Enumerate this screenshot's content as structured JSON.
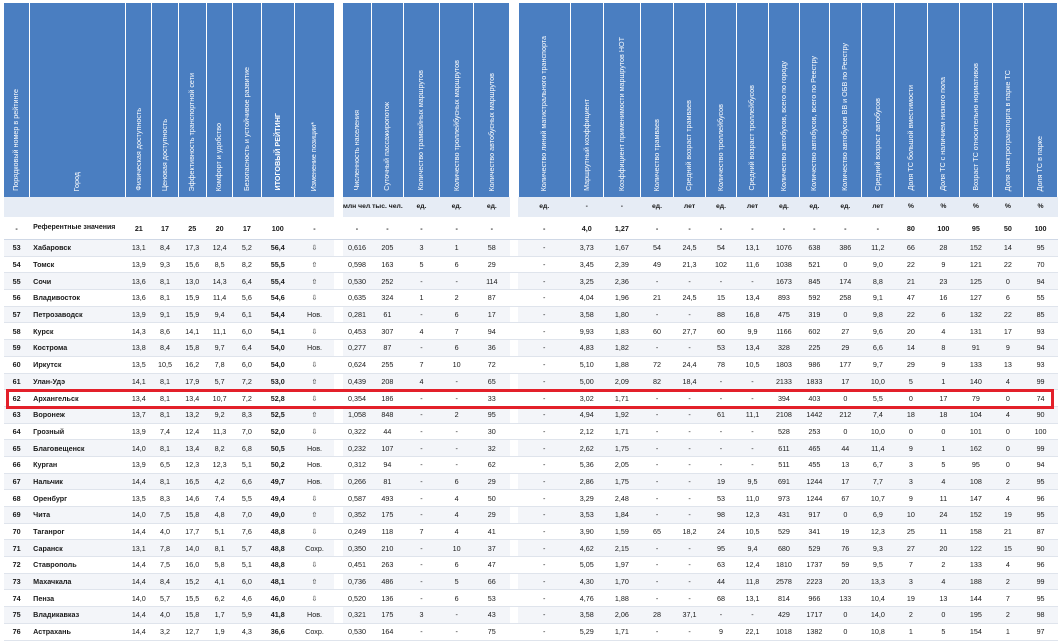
{
  "headers": [
    "Порядковый номер в рейтинге",
    "Город",
    "Физическая доступность",
    "Ценовая доступность",
    "Эффективность транспортной сети",
    "Комфорт и удобство",
    "Безопасность и устойчивое развитие",
    "ИТОГОВЫЙ РЕЙТИНГ",
    "Изменение позиции*",
    "",
    "Численность населения",
    "Суточный пассажиропоток",
    "Количество трамвайных маршрутов",
    "Количество троллейбусных маршрутов",
    "Количество автобусных маршрутов",
    "",
    "Количество линий магистрального транспорта",
    "Маршрутный коэффициент",
    "Коэффициент применимости маршрутов НОТ",
    "Количество трамваев",
    "Средний возраст трамваев",
    "Количество троллейбусов",
    "Средний возраст троллейбусов",
    "Количество автобусов, всего по городу",
    "Количество автобусов, всего по Реестру",
    "Количество автобусов ВВ и ОБВ по Реестру",
    "Средний возраст автобусов",
    "Доля ТС большой вместимости",
    "Доля ТС с наличием низкого пола",
    "Возраст ТС относительно нормативов",
    "Доля электротранспорта в парке ТС",
    "Доля ТС в парке"
  ],
  "units": [
    "",
    "",
    "",
    "",
    "",
    "",
    "",
    "",
    "",
    "",
    "млн чел.",
    "тыс. чел.",
    "ед.",
    "ед.",
    "ед.",
    "",
    "ед.",
    "-",
    "-",
    "ед.",
    "лет",
    "ед.",
    "лет",
    "ед.",
    "ед.",
    "ед.",
    "лет",
    "%",
    "%",
    "%",
    "%",
    "%"
  ],
  "reference": [
    "-",
    "Референтные значения",
    "21",
    "17",
    "25",
    "20",
    "17",
    "100",
    "-",
    "",
    "-",
    "-",
    "-",
    "-",
    "-",
    "",
    "-",
    "4,0",
    "1,27",
    "-",
    "-",
    "-",
    "-",
    "-",
    "-",
    "-",
    "-",
    "80",
    "100",
    "95",
    "50",
    "100"
  ],
  "rows": [
    [
      "53",
      "Хабаровск",
      "13,1",
      "8,4",
      "17,3",
      "12,4",
      "5,2",
      "56,4",
      "⇩",
      "",
      "0,616",
      "205",
      "3",
      "1",
      "58",
      "",
      "-",
      "3,73",
      "1,67",
      "54",
      "24,5",
      "54",
      "13,1",
      "1076",
      "638",
      "386",
      "11,2",
      "66",
      "28",
      "152",
      "14",
      "95"
    ],
    [
      "54",
      "Томск",
      "13,9",
      "9,3",
      "15,6",
      "8,5",
      "8,2",
      "55,5",
      "⇧",
      "",
      "0,598",
      "163",
      "5",
      "6",
      "29",
      "",
      "-",
      "3,45",
      "2,39",
      "49",
      "21,3",
      "102",
      "11,6",
      "1038",
      "521",
      "0",
      "9,0",
      "22",
      "9",
      "121",
      "22",
      "70"
    ],
    [
      "55",
      "Сочи",
      "13,6",
      "8,1",
      "13,0",
      "14,3",
      "6,4",
      "55,4",
      "⇧",
      "",
      "0,530",
      "252",
      "-",
      "-",
      "114",
      "",
      "-",
      "3,25",
      "2,36",
      "-",
      "-",
      "-",
      "-",
      "1673",
      "845",
      "174",
      "8,8",
      "21",
      "23",
      "125",
      "0",
      "94"
    ],
    [
      "56",
      "Владивосток",
      "13,6",
      "8,1",
      "15,9",
      "11,4",
      "5,6",
      "54,6",
      "⇩",
      "",
      "0,635",
      "324",
      "1",
      "2",
      "87",
      "",
      "-",
      "4,04",
      "1,96",
      "21",
      "24,5",
      "15",
      "13,4",
      "893",
      "592",
      "258",
      "9,1",
      "47",
      "16",
      "127",
      "6",
      "55"
    ],
    [
      "57",
      "Петрозаводск",
      "13,9",
      "9,1",
      "15,9",
      "9,4",
      "6,1",
      "54,4",
      "Нов.",
      "",
      "0,281",
      "61",
      "-",
      "6",
      "17",
      "",
      "-",
      "3,58",
      "1,80",
      "-",
      "-",
      "88",
      "16,8",
      "475",
      "319",
      "0",
      "9,8",
      "22",
      "6",
      "132",
      "22",
      "85"
    ],
    [
      "58",
      "Курск",
      "14,3",
      "8,6",
      "14,1",
      "11,1",
      "6,0",
      "54,1",
      "⇩",
      "",
      "0,453",
      "307",
      "4",
      "7",
      "94",
      "",
      "-",
      "9,93",
      "1,83",
      "60",
      "27,7",
      "60",
      "9,9",
      "1166",
      "602",
      "27",
      "9,6",
      "20",
      "4",
      "131",
      "17",
      "93"
    ],
    [
      "59",
      "Кострома",
      "13,8",
      "8,4",
      "15,8",
      "9,7",
      "6,4",
      "54,0",
      "Нов.",
      "",
      "0,277",
      "87",
      "-",
      "6",
      "36",
      "",
      "-",
      "4,83",
      "1,82",
      "-",
      "-",
      "53",
      "13,4",
      "328",
      "225",
      "29",
      "6,6",
      "14",
      "8",
      "91",
      "9",
      "94"
    ],
    [
      "60",
      "Иркутск",
      "13,5",
      "10,5",
      "16,2",
      "7,8",
      "6,0",
      "54,0",
      "⇩",
      "",
      "0,624",
      "255",
      "7",
      "10",
      "72",
      "",
      "-",
      "5,10",
      "1,88",
      "72",
      "24,4",
      "78",
      "10,5",
      "1803",
      "986",
      "177",
      "9,7",
      "29",
      "9",
      "133",
      "13",
      "93"
    ],
    [
      "61",
      "Улан-Удэ",
      "14,1",
      "8,1",
      "17,9",
      "5,7",
      "7,2",
      "53,0",
      "⇧",
      "",
      "0,439",
      "208",
      "4",
      "-",
      "65",
      "",
      "-",
      "5,00",
      "2,09",
      "82",
      "18,4",
      "-",
      "-",
      "2133",
      "1833",
      "17",
      "10,0",
      "5",
      "1",
      "140",
      "4",
      "99"
    ],
    [
      "62",
      "Архангельск",
      "13,4",
      "8,1",
      "13,4",
      "10,7",
      "7,2",
      "52,8",
      "⇩",
      "",
      "0,354",
      "186",
      "-",
      "-",
      "33",
      "",
      "-",
      "3,02",
      "1,71",
      "-",
      "-",
      "-",
      "-",
      "394",
      "403",
      "0",
      "5,5",
      "0",
      "17",
      "79",
      "0",
      "74"
    ],
    [
      "63",
      "Воронеж",
      "13,7",
      "8,1",
      "13,2",
      "9,2",
      "8,3",
      "52,5",
      "⇧",
      "",
      "1,058",
      "848",
      "-",
      "2",
      "95",
      "",
      "-",
      "4,94",
      "1,92",
      "-",
      "-",
      "61",
      "11,1",
      "2108",
      "1442",
      "212",
      "7,4",
      "18",
      "18",
      "104",
      "4",
      "90"
    ],
    [
      "64",
      "Грозный",
      "13,9",
      "7,4",
      "12,4",
      "11,3",
      "7,0",
      "52,0",
      "⇩",
      "",
      "0,322",
      "44",
      "-",
      "-",
      "30",
      "",
      "-",
      "2,12",
      "1,71",
      "-",
      "-",
      "-",
      "-",
      "528",
      "253",
      "0",
      "10,0",
      "0",
      "0",
      "101",
      "0",
      "100"
    ],
    [
      "65",
      "Благовещенск",
      "14,0",
      "8,1",
      "13,4",
      "8,2",
      "6,8",
      "50,5",
      "Нов.",
      "",
      "0,232",
      "107",
      "-",
      "-",
      "32",
      "",
      "-",
      "2,62",
      "1,75",
      "-",
      "-",
      "-",
      "-",
      "611",
      "465",
      "44",
      "11,4",
      "9",
      "1",
      "162",
      "0",
      "99"
    ],
    [
      "66",
      "Курган",
      "13,9",
      "6,5",
      "12,3",
      "12,3",
      "5,1",
      "50,2",
      "Нов.",
      "",
      "0,312",
      "94",
      "-",
      "-",
      "62",
      "",
      "-",
      "5,36",
      "2,05",
      "-",
      "-",
      "-",
      "-",
      "511",
      "455",
      "13",
      "6,7",
      "3",
      "5",
      "95",
      "0",
      "94"
    ],
    [
      "67",
      "Нальчик",
      "14,4",
      "8,1",
      "16,5",
      "4,2",
      "6,6",
      "49,7",
      "Нов.",
      "",
      "0,266",
      "81",
      "-",
      "6",
      "29",
      "",
      "-",
      "2,86",
      "1,75",
      "-",
      "-",
      "19",
      "9,5",
      "691",
      "1244",
      "17",
      "7,7",
      "3",
      "4",
      "108",
      "2",
      "95"
    ],
    [
      "68",
      "Оренбург",
      "13,5",
      "8,3",
      "14,6",
      "7,4",
      "5,5",
      "49,4",
      "⇩",
      "",
      "0,587",
      "493",
      "-",
      "4",
      "50",
      "",
      "-",
      "3,29",
      "2,48",
      "-",
      "-",
      "53",
      "11,0",
      "973",
      "1244",
      "67",
      "10,7",
      "9",
      "11",
      "147",
      "4",
      "96"
    ],
    [
      "69",
      "Чита",
      "14,0",
      "7,5",
      "15,8",
      "4,8",
      "7,0",
      "49,0",
      "⇧",
      "",
      "0,352",
      "175",
      "-",
      "4",
      "29",
      "",
      "-",
      "3,53",
      "1,84",
      "-",
      "-",
      "98",
      "12,3",
      "431",
      "917",
      "0",
      "6,9",
      "10",
      "24",
      "152",
      "19",
      "95"
    ],
    [
      "70",
      "Таганрог",
      "14,4",
      "4,0",
      "17,7",
      "5,1",
      "7,6",
      "48,8",
      "⇩",
      "",
      "0,249",
      "118",
      "7",
      "4",
      "41",
      "",
      "-",
      "3,90",
      "1,59",
      "65",
      "18,2",
      "24",
      "10,5",
      "529",
      "341",
      "19",
      "12,3",
      "25",
      "11",
      "158",
      "21",
      "87"
    ],
    [
      "71",
      "Саранск",
      "13,1",
      "7,8",
      "14,0",
      "8,1",
      "5,7",
      "48,8",
      "Сохр.",
      "",
      "0,350",
      "210",
      "-",
      "10",
      "37",
      "",
      "-",
      "4,62",
      "2,15",
      "-",
      "-",
      "95",
      "9,4",
      "680",
      "529",
      "76",
      "9,3",
      "27",
      "20",
      "122",
      "15",
      "90"
    ],
    [
      "72",
      "Ставрополь",
      "14,4",
      "7,5",
      "16,0",
      "5,8",
      "5,1",
      "48,8",
      "⇩",
      "",
      "0,451",
      "263",
      "-",
      "6",
      "47",
      "",
      "-",
      "5,05",
      "1,97",
      "-",
      "-",
      "63",
      "12,4",
      "1810",
      "1737",
      "59",
      "9,5",
      "7",
      "2",
      "133",
      "4",
      "96"
    ],
    [
      "73",
      "Махачкала",
      "14,4",
      "8,4",
      "15,2",
      "4,1",
      "6,0",
      "48,1",
      "⇧",
      "",
      "0,736",
      "486",
      "-",
      "5",
      "66",
      "",
      "-",
      "4,30",
      "1,70",
      "-",
      "-",
      "44",
      "11,8",
      "2578",
      "2223",
      "20",
      "13,3",
      "3",
      "4",
      "188",
      "2",
      "99"
    ],
    [
      "74",
      "Пенза",
      "14,0",
      "5,7",
      "15,5",
      "6,2",
      "4,6",
      "46,0",
      "⇩",
      "",
      "0,520",
      "136",
      "-",
      "6",
      "53",
      "",
      "-",
      "4,76",
      "1,88",
      "-",
      "-",
      "68",
      "13,1",
      "814",
      "966",
      "133",
      "10,4",
      "19",
      "13",
      "144",
      "7",
      "95"
    ],
    [
      "75",
      "Владикавказ",
      "14,4",
      "4,0",
      "15,8",
      "1,7",
      "5,9",
      "41,8",
      "Нов.",
      "",
      "0,321",
      "175",
      "3",
      "-",
      "43",
      "",
      "-",
      "3,58",
      "2,06",
      "28",
      "37,1",
      "-",
      "-",
      "429",
      "1717",
      "0",
      "14,0",
      "2",
      "0",
      "195",
      "2",
      "98"
    ],
    [
      "76",
      "Астрахань",
      "14,4",
      "3,2",
      "12,7",
      "1,9",
      "4,3",
      "36,6",
      "Сохр.",
      "",
      "0,530",
      "164",
      "-",
      "-",
      "75",
      "",
      "-",
      "5,29",
      "1,71",
      "-",
      "-",
      "9",
      "22,1",
      "1018",
      "1382",
      "0",
      "10,8",
      "1",
      "5",
      "154",
      "1",
      "97"
    ]
  ],
  "colors": {
    "header_bg": "#4a7ec1",
    "highlight": "#e3202a",
    "unit_row_bg": "#e6ecf5"
  }
}
